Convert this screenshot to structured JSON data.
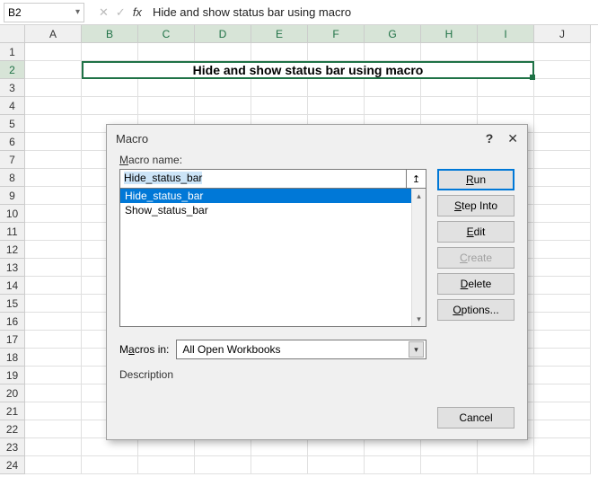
{
  "formula_bar": {
    "name_box": "B2",
    "fx_label": "fx",
    "content": "Hide and show status bar using macro"
  },
  "columns": [
    "A",
    "B",
    "C",
    "D",
    "E",
    "F",
    "G",
    "H",
    "I",
    "J"
  ],
  "rows": [
    "1",
    "2",
    "3",
    "4",
    "5",
    "6",
    "7",
    "8",
    "9",
    "10",
    "11",
    "12",
    "13",
    "14",
    "15",
    "16",
    "17",
    "18",
    "19",
    "20",
    "21",
    "22",
    "23",
    "24"
  ],
  "merged_cell_text": "Hide and show status bar using macro",
  "dialog": {
    "title": "Macro",
    "help": "?",
    "close": "✕",
    "macro_name_label_prefix": "M",
    "macro_name_label_rest": "acro name:",
    "macro_name_value": "Hide_status_bar",
    "ref_glyph": "↥",
    "list": [
      {
        "label": "Hide_status_bar",
        "selected": true
      },
      {
        "label": "Show_status_bar",
        "selected": false
      }
    ],
    "macros_in_label_prefix": "M",
    "macros_in_underline": "a",
    "macros_in_label_rest": "cros in:",
    "macros_in_value": "All Open Workbooks",
    "description_label": "Description",
    "buttons": {
      "run_u": "R",
      "run_rest": "un",
      "stepinto_u": "S",
      "stepinto_rest": "tep Into",
      "edit_u": "E",
      "edit_rest": "dit",
      "create_u": "C",
      "create_rest": "reate",
      "delete_u": "D",
      "delete_rest": "elete",
      "options_u": "O",
      "options_rest": "ptions...",
      "cancel": "Cancel"
    }
  }
}
